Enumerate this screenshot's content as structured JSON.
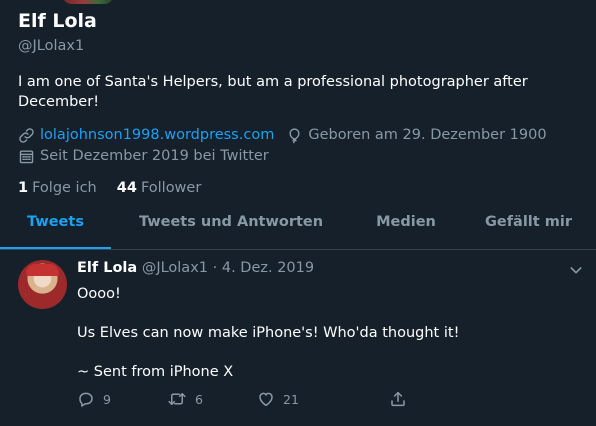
{
  "profile": {
    "name": "Elf Lola",
    "handle": "@JLolax1",
    "bio": "I am one of Santa's Helpers, but am a professional photographer after December!",
    "website": "lolajohnson1998.wordpress.com",
    "birthday": "Geboren am 29. Dezember 1900",
    "joined": "Seit Dezember 2019 bei Twitter",
    "following_count": "1",
    "following_label": "Folge ich",
    "followers_count": "44",
    "followers_label": "Follower"
  },
  "tabs": [
    {
      "label": "Tweets",
      "active": true
    },
    {
      "label": "Tweets und Antworten",
      "active": false
    },
    {
      "label": "Medien",
      "active": false
    },
    {
      "label": "Gefällt mir",
      "active": false
    }
  ],
  "tweet": {
    "name": "Elf Lola",
    "handle": "@JLolax1",
    "separator": "·",
    "date": "4. Dez. 2019",
    "lines": [
      "Oooo!",
      "Us Elves can now make iPhone's! Who'da thought it!",
      "~ Sent from iPhone X"
    ],
    "replies": "9",
    "retweets": "6",
    "likes": "21"
  },
  "icons": {
    "website": "link-icon",
    "birthday": "balloon-icon",
    "joined": "calendar-icon",
    "menu": "chevron-down-icon",
    "reply": "reply-icon",
    "retweet": "retweet-icon",
    "like": "heart-icon",
    "share": "share-icon"
  },
  "colors": {
    "background": "#15202b",
    "accent": "#1da1f2",
    "secondary_text": "#8899a6",
    "divider": "#38444d"
  }
}
